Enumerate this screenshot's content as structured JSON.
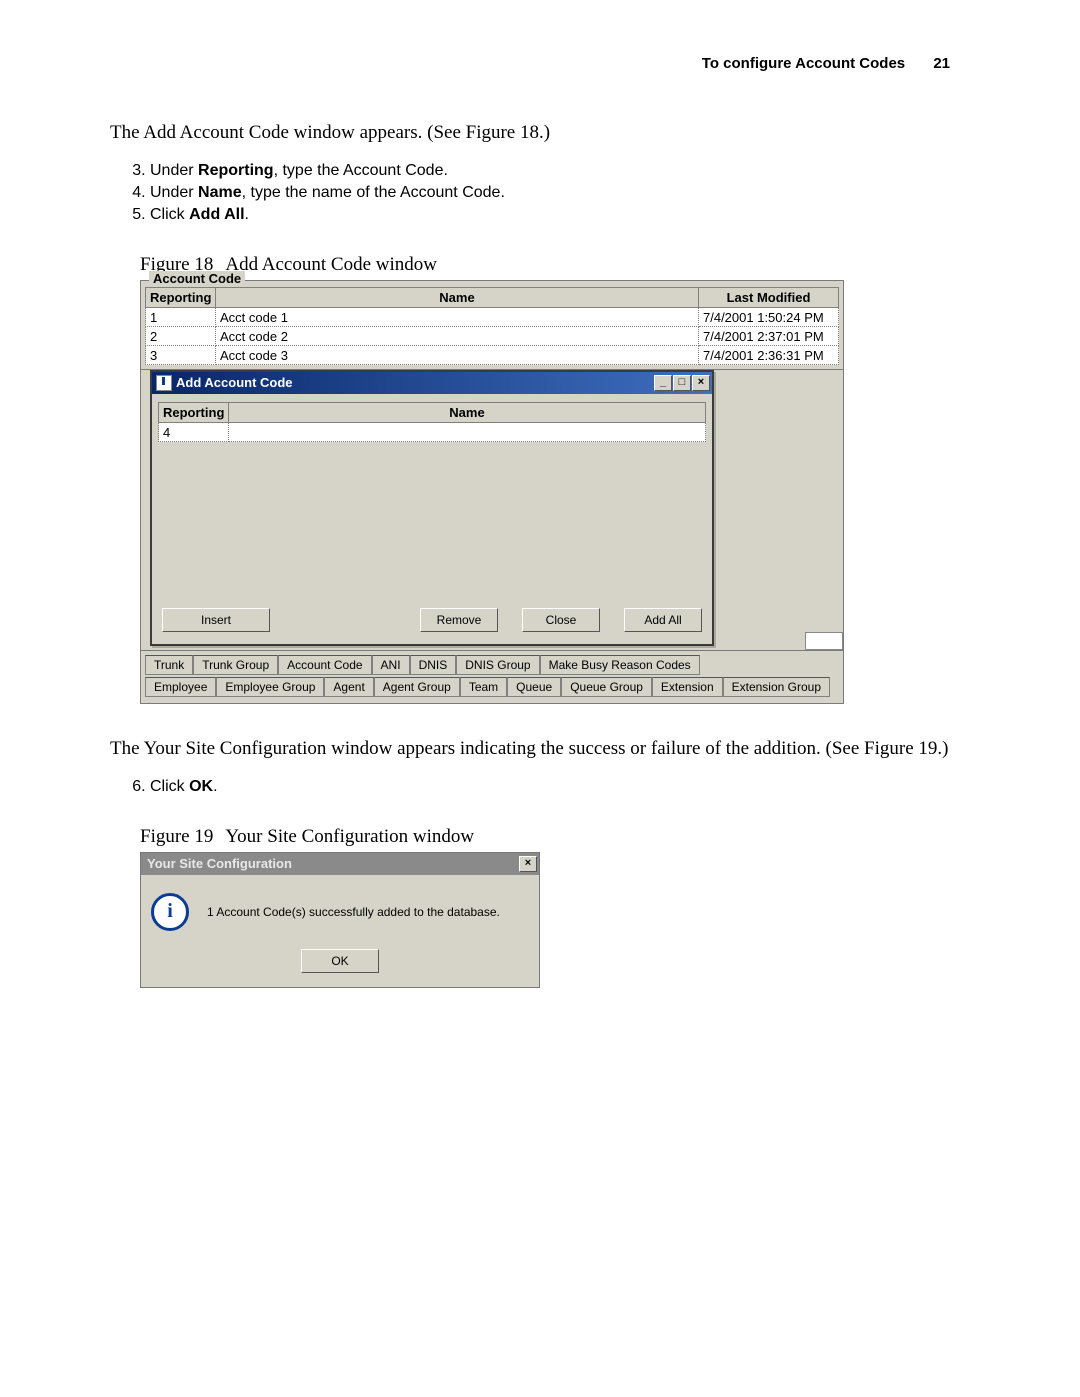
{
  "header": {
    "title": "To configure Account Codes",
    "page_number": "21"
  },
  "intro": "The Add Account Code window appears. (See Figure 18.)",
  "steps_a": [
    {
      "n": "3",
      "pre": "Under ",
      "bold": "Reporting",
      "post": ", type the Account Code."
    },
    {
      "n": "4",
      "pre": "Under ",
      "bold": "Name",
      "post": ", type the name of the Account Code."
    },
    {
      "n": "5",
      "pre": "Click ",
      "bold": "Add All",
      "post": "."
    }
  ],
  "fig18": {
    "caption_prefix": "Figure 18",
    "caption_text": "Add Account Code window",
    "fieldset_label": "Account Code",
    "headers": {
      "reporting": "Reporting",
      "name": "Name",
      "modified": "Last Modified"
    },
    "rows": [
      {
        "reporting": "1",
        "name": "Acct code 1",
        "modified": "7/4/2001 1:50:24 PM"
      },
      {
        "reporting": "2",
        "name": "Acct code 2",
        "modified": "7/4/2001 2:37:01 PM"
      },
      {
        "reporting": "3",
        "name": "Acct code 3",
        "modified": "7/4/2001 2:36:31 PM"
      }
    ],
    "dialog": {
      "title": "Add Account Code",
      "headers": {
        "reporting": "Reporting",
        "name": "Name"
      },
      "row": {
        "reporting": "4",
        "name": ""
      },
      "buttons": {
        "insert": "Insert",
        "remove": "Remove",
        "close": "Close",
        "add_all": "Add All"
      },
      "win_buttons": {
        "min": "_",
        "max": "□",
        "close": "×"
      }
    },
    "tabs_row1": [
      "Trunk",
      "Trunk Group",
      "Account Code",
      "ANI",
      "DNIS",
      "DNIS Group",
      "Make Busy Reason Codes"
    ],
    "tabs_row2": [
      "Employee",
      "Employee Group",
      "Agent",
      "Agent Group",
      "Team",
      "Queue",
      "Queue Group",
      "Extension",
      "Extension Group"
    ]
  },
  "after": "The Your Site Configuration window appears indicating the success or failure of the addition. (See Figure 19.)",
  "steps_b": [
    {
      "n": "6",
      "pre": "Click ",
      "bold": "OK",
      "post": "."
    }
  ],
  "fig19": {
    "caption_prefix": "Figure 19",
    "caption_text": "Your Site Configuration window",
    "title": "Your Site Configuration",
    "message": "1 Account Code(s) successfully added to the database.",
    "close_glyph": "×",
    "info_glyph": "i",
    "ok": "OK"
  }
}
